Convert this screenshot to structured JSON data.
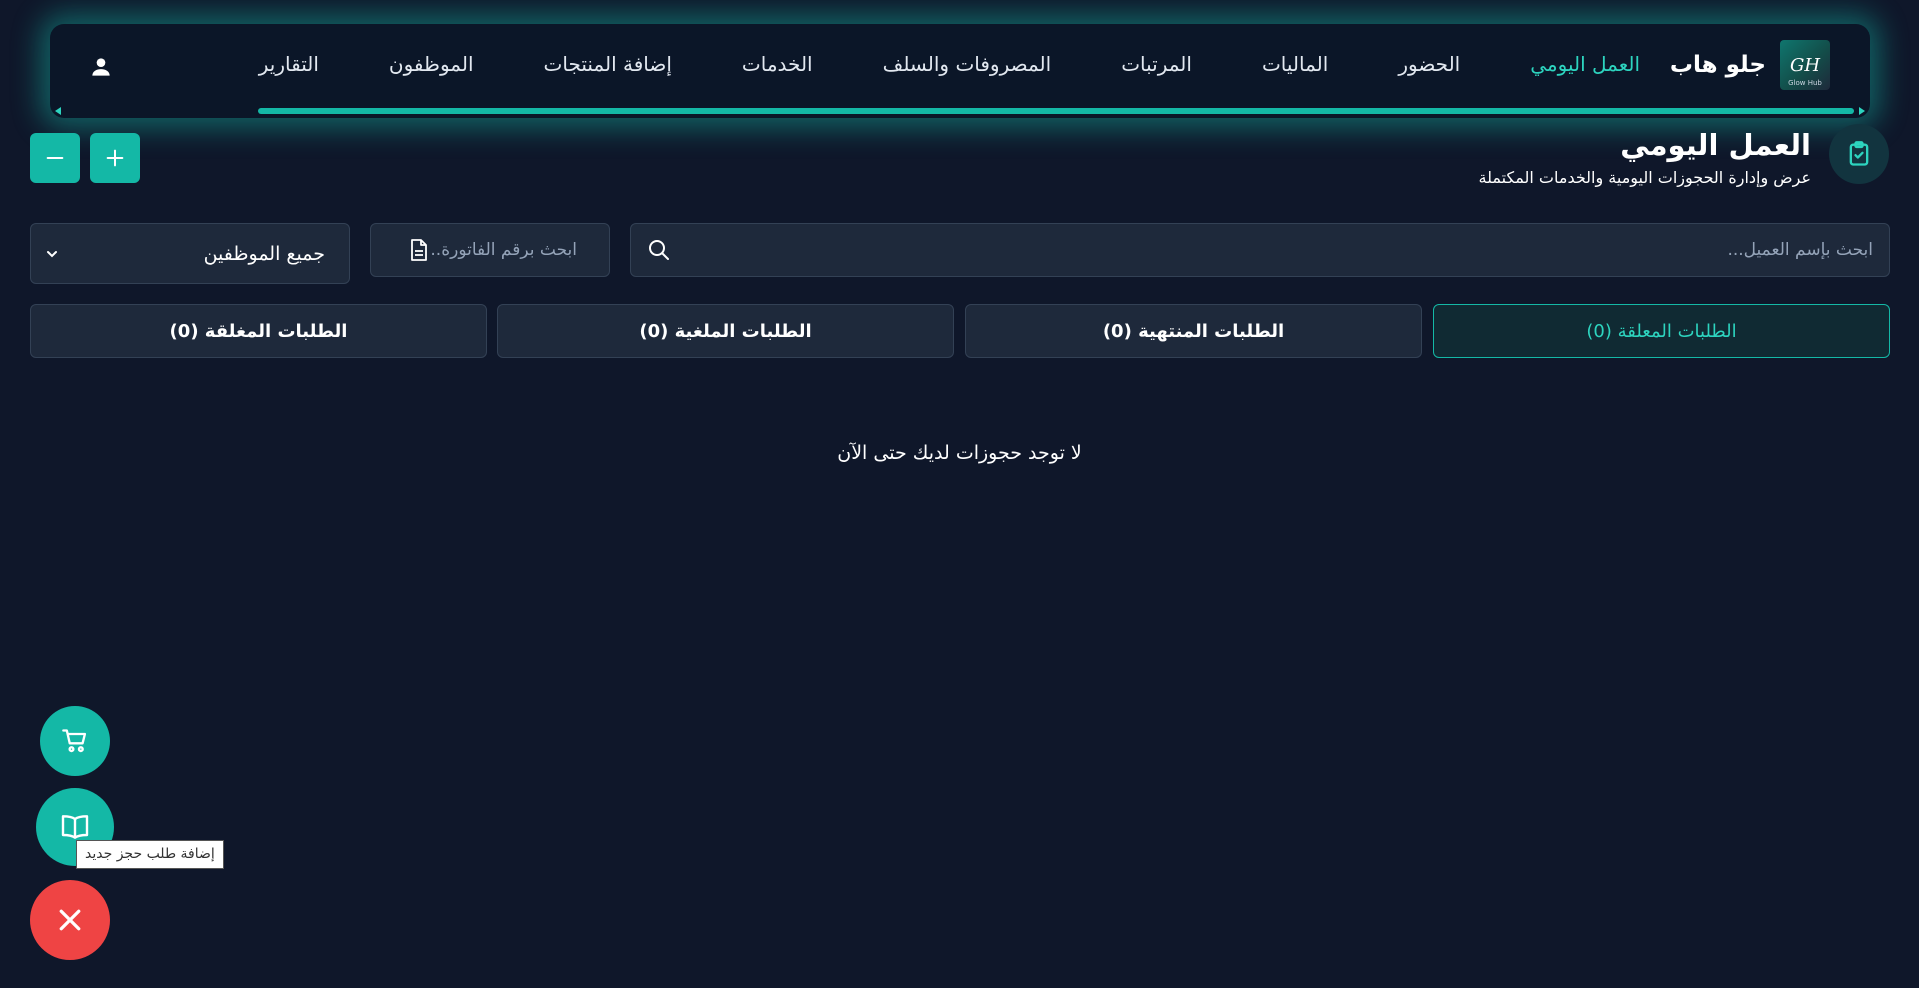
{
  "brand": {
    "name": "جلو هاب",
    "logo_text": "GH",
    "logo_subtext": "Glow Hub"
  },
  "nav": {
    "items": [
      {
        "label": "العمل اليومي",
        "active": true
      },
      {
        "label": "الحضور"
      },
      {
        "label": "الماليات"
      },
      {
        "label": "المرتبات"
      },
      {
        "label": "المصروفات والسلف"
      },
      {
        "label": "الخدمات"
      },
      {
        "label": "إضافة المنتجات"
      },
      {
        "label": "الموظفون"
      },
      {
        "label": "التقارير"
      }
    ],
    "user_icon": "user-icon"
  },
  "page": {
    "title": "العمل اليومي",
    "subtitle": "عرض وإدارة الحجوزات اليومية والخدمات المكتملة",
    "icon": "clipboard-check-icon"
  },
  "zoom": {
    "plus_icon": "plus-icon",
    "minus_icon": "minus-icon"
  },
  "filters": {
    "search_placeholder": "ابحث بإسم العميل...",
    "invoice_placeholder": "ابحث برقم الفاتورة..",
    "employee_selected": "جميع الموظفين"
  },
  "tabs": [
    {
      "label": "الطلبات المعلقة (0)",
      "active": true
    },
    {
      "label": "الطلبات المنتهية (0)"
    },
    {
      "label": "الطلبات الملغية (0)"
    },
    {
      "label": "الطلبات المغلقة (0)"
    }
  ],
  "empty_message": "لا توجد حجوزات لديك حتى الآن",
  "fab": {
    "cart_icon": "cart-icon",
    "book_icon": "book-icon",
    "close_icon": "close-icon",
    "tooltip": "إضافة طلب حجز جديد"
  },
  "colors": {
    "accent": "#14b8a6",
    "accent_text": "#2dd4bf",
    "background": "#0f172a",
    "danger": "#ef4444"
  }
}
